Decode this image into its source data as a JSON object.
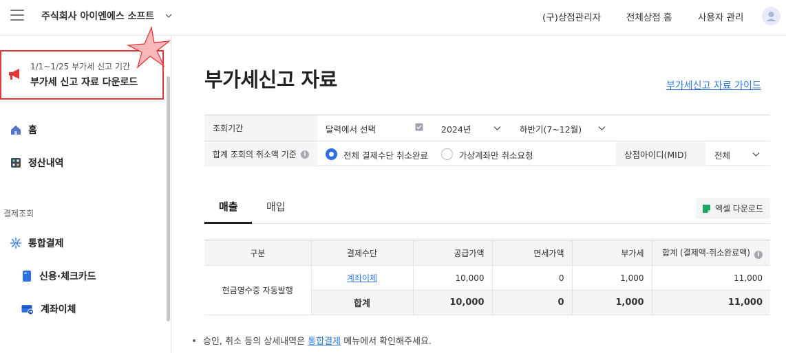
{
  "topbar": {
    "company": "주식회사 아이엔에스 소프트",
    "links": [
      "(구)상점관리자",
      "전체상점 홈",
      "사용자 관리"
    ]
  },
  "sidebar": {
    "notice": {
      "subtitle": "1/1~1/25 부가세 신고 기간",
      "title": "부가세 신고 자료 다운로드"
    },
    "items": [
      {
        "label": "홈",
        "icon": "home-icon"
      },
      {
        "label": "정산내역",
        "icon": "calculator-icon"
      }
    ],
    "section": "결제조회",
    "payment": {
      "label": "통합결제",
      "icon": "payment-spark-icon"
    },
    "sub_items": [
      {
        "label": "신용·체크카드",
        "icon": "card-icon"
      },
      {
        "label": "계좌이체",
        "icon": "bank-transfer-icon"
      }
    ]
  },
  "main": {
    "title": "부가세신고 자료",
    "guide_link": "부가세신고 자료 가이드",
    "filter": {
      "period_label": "조회기간",
      "period_select": "달력에서 선택",
      "year": "2024년",
      "half": "하반기(7~12월)",
      "cancel_label": "합계 조회의 취소액 기준",
      "radio_on": "전체 결제수단 취소완료",
      "radio_off": "가상계좌만 취소요청",
      "mid_label": "상점아이디(MID)",
      "mid_value": "전체"
    },
    "tabs": [
      "매출",
      "매입"
    ],
    "excel_button": "엑셀 다운로드",
    "table": {
      "headers": [
        "구분",
        "결제수단",
        "공급가액",
        "면세가액",
        "부가세",
        "합계 (결제액-취소완료액)"
      ],
      "category": "현금영수증 자동발행",
      "row": {
        "method": "계좌이체",
        "supply": "10,000",
        "taxfree": "0",
        "vat": "1,000",
        "total": "11,000"
      },
      "total_row": {
        "label": "합계",
        "supply": "10,000",
        "taxfree": "0",
        "vat": "1,000",
        "total": "11,000"
      }
    },
    "notes": {
      "n1_pre": "승인, 취소 등의 상세내역은",
      "n1_link": "통합결제",
      "n1_post": "메뉴에서 확인해주세요."
    }
  },
  "colors": {
    "accent": "#2f7cdc",
    "notice_border": "#e2383a",
    "radio": "#2f6fe4",
    "excel": "#1fa463"
  }
}
